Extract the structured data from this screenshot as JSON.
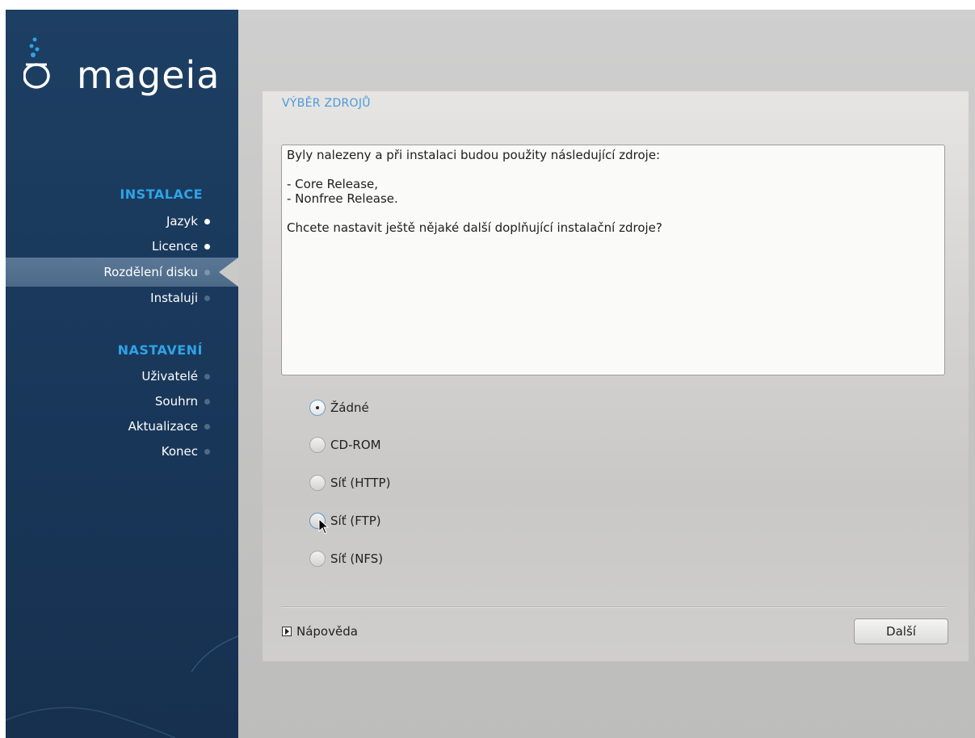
{
  "sidebar": {
    "logo_text": "mageia",
    "sections": [
      {
        "title": "INSTALACE",
        "steps": [
          {
            "label": "Jazyk",
            "state": "done"
          },
          {
            "label": "Licence",
            "state": "done"
          },
          {
            "label": "Rozdělení disku",
            "state": "current"
          },
          {
            "label": "Instaluji",
            "state": "pending"
          }
        ]
      },
      {
        "title": "NASTAVENÍ",
        "steps": [
          {
            "label": "Uživatelé",
            "state": "pending"
          },
          {
            "label": "Souhrn",
            "state": "pending"
          },
          {
            "label": "Aktualizace",
            "state": "pending"
          },
          {
            "label": "Konec",
            "state": "pending"
          }
        ]
      }
    ]
  },
  "panel": {
    "title": "VÝBĚR ZDROJŮ",
    "message": {
      "line1": "Byly nalezeny a při instalaci budou použity následující zdroje:",
      "line2": "- Core Release,",
      "line3": "- Nonfree Release.",
      "line4": "Chcete nastavit ještě nějaké další doplňující instalační zdroje?"
    },
    "options": [
      {
        "label": "Žádné",
        "checked": true
      },
      {
        "label": "CD-ROM",
        "checked": false
      },
      {
        "label": "Síť (HTTP)",
        "checked": false
      },
      {
        "label": "Síť (FTP)",
        "checked": false
      },
      {
        "label": "Síť (NFS)",
        "checked": false
      }
    ],
    "help_label": "Nápověda",
    "next_label": "Další"
  },
  "colors": {
    "sidebar_bg": "#1d3f63",
    "section_title": "#2ea3e8",
    "panel_title": "#4a9ad8"
  }
}
